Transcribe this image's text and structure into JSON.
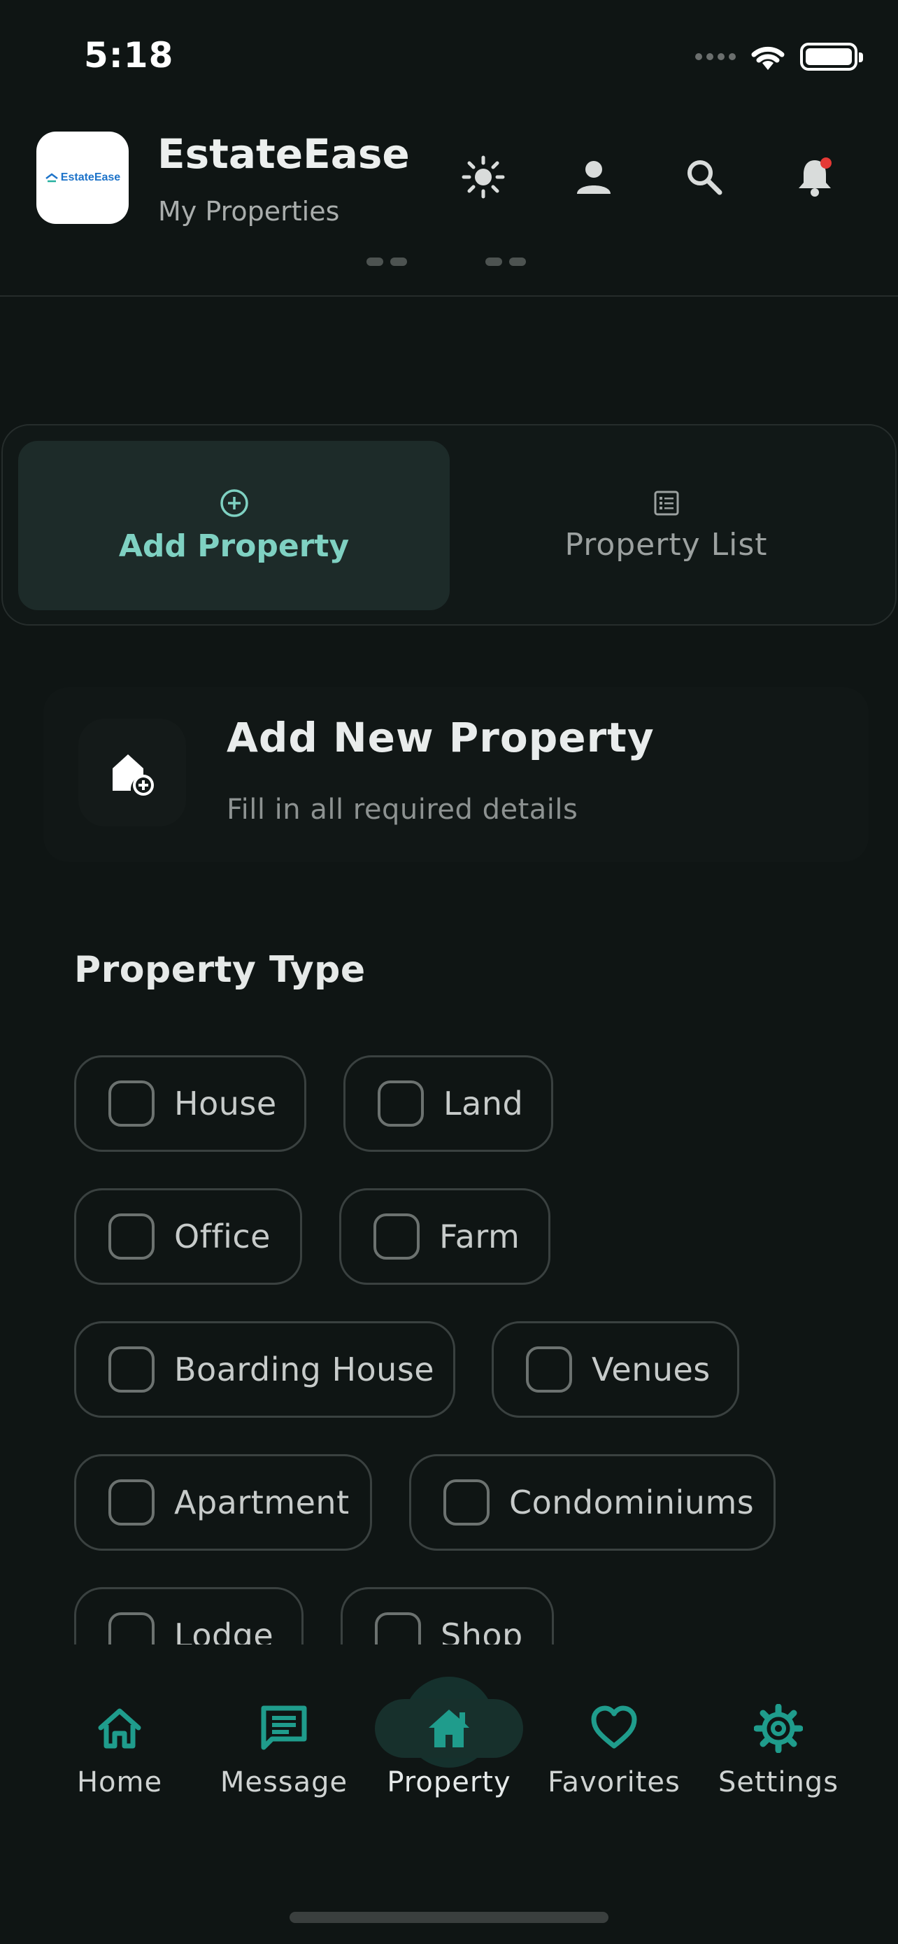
{
  "status_bar": {
    "time": "5:18"
  },
  "header": {
    "logo_text": "EstateEase",
    "title": "EstateEase",
    "subtitle": "My Properties",
    "icons": [
      "sun-icon",
      "user-icon",
      "search-icon",
      "bell-icon"
    ]
  },
  "tabs": [
    {
      "label": "Add Property",
      "icon": "plus-circle-icon",
      "active": true
    },
    {
      "label": "Property List",
      "icon": "list-icon",
      "active": false
    }
  ],
  "card": {
    "title": "Add New Property",
    "subtitle": "Fill in all required details",
    "icon": "house-add-icon"
  },
  "property_type": {
    "title": "Property Type",
    "options": [
      {
        "label": "House",
        "checked": false
      },
      {
        "label": "Land",
        "checked": false
      },
      {
        "label": "Office",
        "checked": false
      },
      {
        "label": "Farm",
        "checked": false
      },
      {
        "label": "Boarding House",
        "checked": false
      },
      {
        "label": "Venues",
        "checked": false
      },
      {
        "label": "Apartment",
        "checked": false
      },
      {
        "label": "Condominiums",
        "checked": false
      },
      {
        "label": "Lodge",
        "checked": false
      },
      {
        "label": "Shop",
        "checked": false
      }
    ]
  },
  "bottom_nav": {
    "items": [
      {
        "label": "Home",
        "icon": "home-icon",
        "active": false
      },
      {
        "label": "Message",
        "icon": "message-icon",
        "active": false
      },
      {
        "label": "Property",
        "icon": "property-icon",
        "active": true
      },
      {
        "label": "Favorites",
        "icon": "heart-icon",
        "active": false
      },
      {
        "label": "Settings",
        "icon": "gear-icon",
        "active": false
      }
    ]
  },
  "colors": {
    "background": "#0f1514",
    "accent": "#1f9c8c",
    "active_tab_text": "#7fd1c2",
    "notification": "#e53935"
  }
}
